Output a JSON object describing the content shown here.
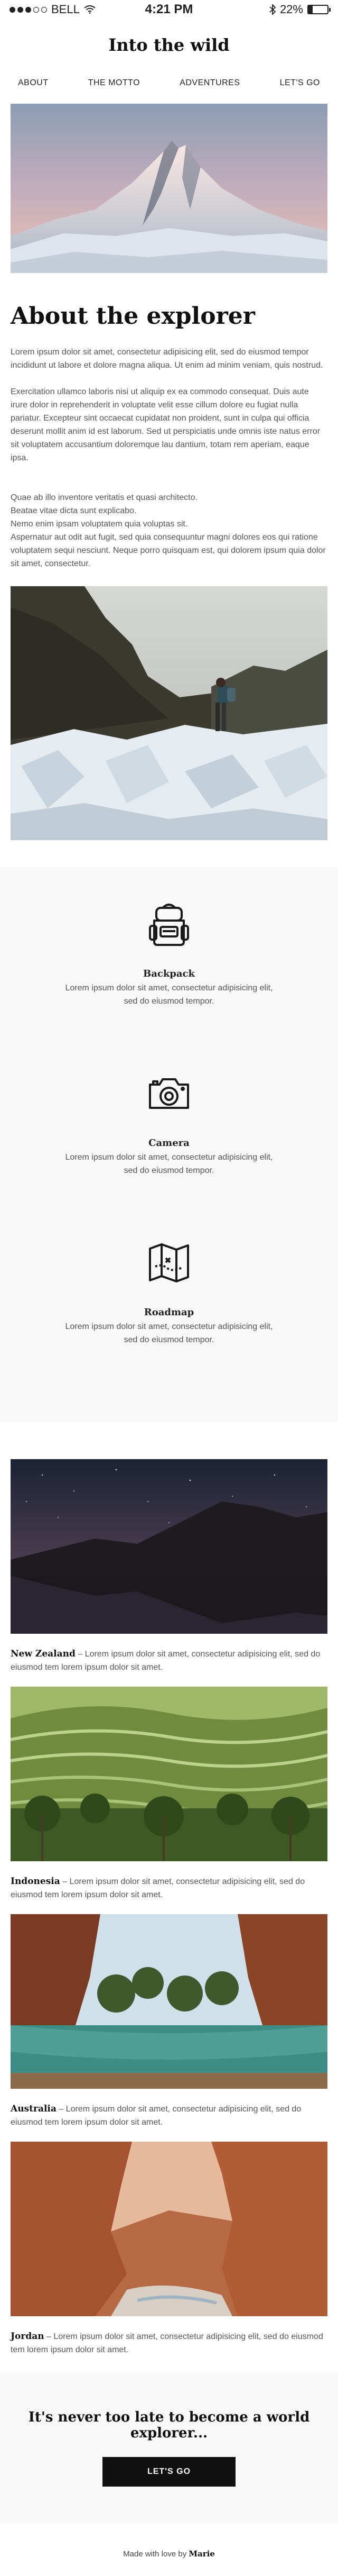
{
  "status_bar": {
    "carrier": "BELL",
    "time": "4:21 PM",
    "battery": "22%",
    "battery_level": 0.22
  },
  "header": {
    "title": "Into the wild",
    "nav": [
      "ABOUT",
      "THE MOTTO",
      "ADVENTURES",
      "LET'S GO"
    ]
  },
  "about": {
    "title": "About the explorer",
    "p1": "Lorem ipsum dolor sit amet, consectetur adipisicing elit, sed do eiusmod tempor incididunt ut labore et dolore magna aliqua. Ut enim ad minim veniam, quis nostrud.",
    "p2": "Exercitation ullamco laboris nisi ut aliquip ex ea commodo consequat. Duis aute irure dolor in reprehenderit in voluptate velit esse cillum dolore eu fugiat nulla pariatur. Excepteur sint occaecat cupidatat non proident, sunt in culpa qui officia deserunt mollit anim id est laborum. Sed ut perspiciatis unde omnis iste natus error sit voluptatem accusantium doloremque lau dantium, totam rem aperiam, eaque ipsa.",
    "p3": "Quae ab illo inventore veritatis et quasi architecto.\nBeatae vitae dicta sunt explicabo.\nNemo enim ipsam voluptatem quia voluptas sit.\nAspernatur aut odit aut fugit, sed quia consequuntur magni dolores eos qui ratione voluptatem sequi nesciunt. Neque porro quisquam est, qui dolorem ipsum quia dolor sit amet, consectetur."
  },
  "features": [
    {
      "title": "Backpack",
      "text": "Lorem ipsum dolor sit amet, consectetur adipisicing elit, sed do eiusmod tempor.",
      "icon": "backpack-icon"
    },
    {
      "title": "Camera",
      "text": "Lorem ipsum dolor sit amet, consectetur adipisicing elit, sed do eiusmod tempor.",
      "icon": "camera-icon"
    },
    {
      "title": "Roadmap",
      "text": "Lorem ipsum dolor sit amet, consectetur adipisicing elit, sed do eiusmod tempor.",
      "icon": "map-icon"
    }
  ],
  "destinations": [
    {
      "name": "New Zealand",
      "text": " – Lorem ipsum dolor sit amet, consectetur adipisicing elit, sed do eiusmod tem lorem ipsum dolor sit amet."
    },
    {
      "name": "Indonesia",
      "text": " – Lorem ipsum dolor sit amet, consectetur adipisicing elit, sed do eiusmod tem lorem ipsum dolor sit amet."
    },
    {
      "name": "Australia",
      "text": " – Lorem ipsum dolor sit amet, consectetur adipisicing elit, sed do eiusmod tem lorem ipsum dolor sit amet."
    },
    {
      "name": "Jordan",
      "text": " – Lorem ipsum dolor sit amet, consectetur adipisicing elit, sed do eiusmod tem lorem ipsum dolor sit amet."
    }
  ],
  "cta": {
    "heading": "It's never too late to become a world explorer...",
    "button": "LET'S GO"
  },
  "footer": {
    "prefix": "Made with love by ",
    "author": "Marie"
  }
}
